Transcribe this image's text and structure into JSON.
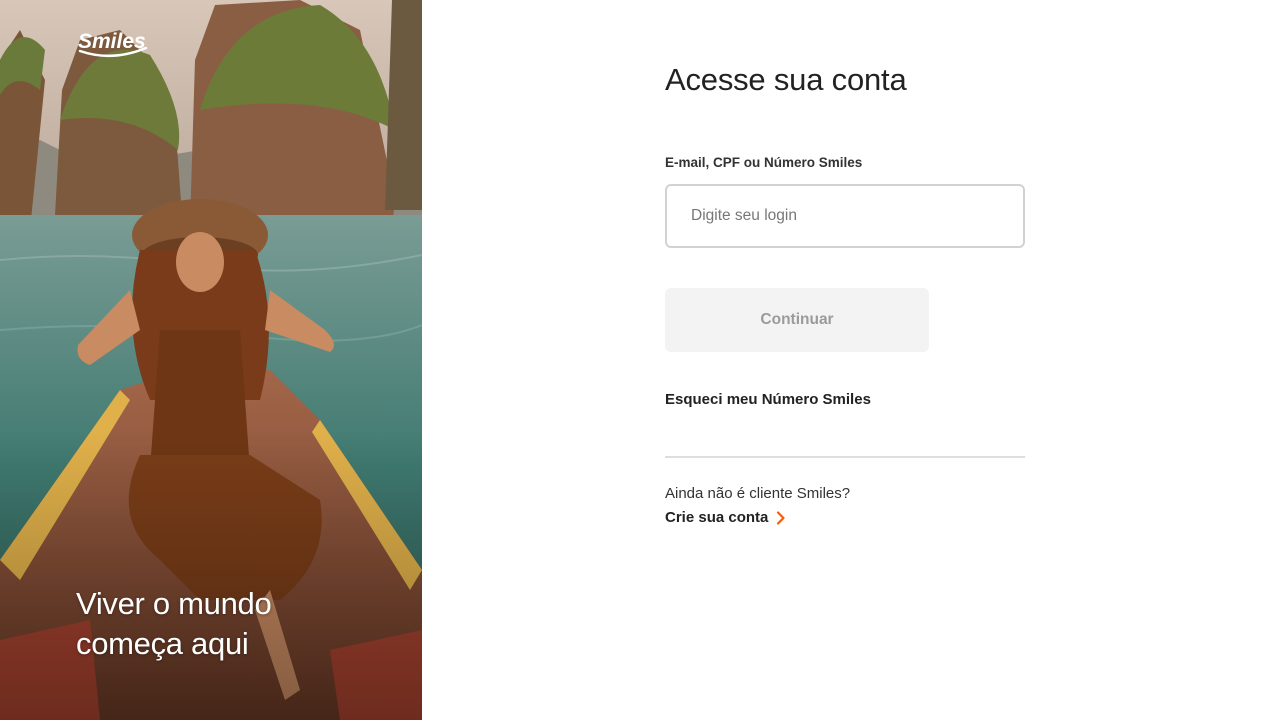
{
  "brand": {
    "logo_text": "Smiles",
    "hero_line1": "Viver o mundo",
    "hero_line2": "começa aqui"
  },
  "form": {
    "title": "Acesse sua conta",
    "login_label": "E-mail, CPF ou Número Smiles",
    "login_placeholder": "Digite seu login",
    "login_value": "",
    "continue_label": "Continuar",
    "forgot_label": "Esqueci meu Número Smiles",
    "not_client_text": "Ainda não é cliente Smiles?",
    "create_account_label": "Crie sua conta"
  },
  "icons": {
    "chevron": "chevron-right-icon",
    "logo": "smiles-logo"
  },
  "colors": {
    "accent": "#ff5a00",
    "button_disabled_bg": "#f3f3f3",
    "button_disabled_text": "#9a9a9a",
    "input_border": "#d2d2d2"
  }
}
